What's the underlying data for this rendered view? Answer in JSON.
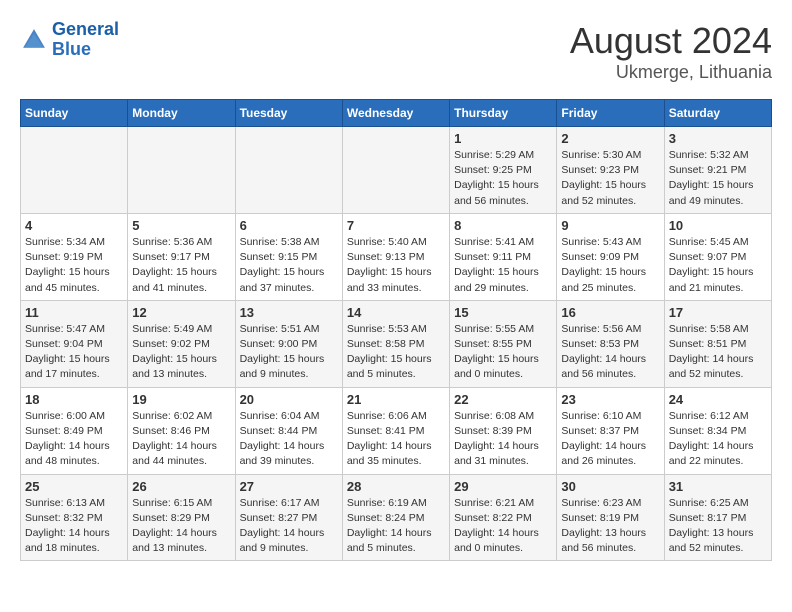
{
  "logo": {
    "line1": "General",
    "line2": "Blue"
  },
  "title": "August 2024",
  "subtitle": "Ukmerge, Lithuania",
  "days_of_week": [
    "Sunday",
    "Monday",
    "Tuesday",
    "Wednesday",
    "Thursday",
    "Friday",
    "Saturday"
  ],
  "weeks": [
    {
      "cells": [
        {
          "day": null,
          "content": null
        },
        {
          "day": null,
          "content": null
        },
        {
          "day": null,
          "content": null
        },
        {
          "day": null,
          "content": null
        },
        {
          "day": "1",
          "content": "Sunrise: 5:29 AM\nSunset: 9:25 PM\nDaylight: 15 hours\nand 56 minutes."
        },
        {
          "day": "2",
          "content": "Sunrise: 5:30 AM\nSunset: 9:23 PM\nDaylight: 15 hours\nand 52 minutes."
        },
        {
          "day": "3",
          "content": "Sunrise: 5:32 AM\nSunset: 9:21 PM\nDaylight: 15 hours\nand 49 minutes."
        }
      ]
    },
    {
      "cells": [
        {
          "day": "4",
          "content": "Sunrise: 5:34 AM\nSunset: 9:19 PM\nDaylight: 15 hours\nand 45 minutes."
        },
        {
          "day": "5",
          "content": "Sunrise: 5:36 AM\nSunset: 9:17 PM\nDaylight: 15 hours\nand 41 minutes."
        },
        {
          "day": "6",
          "content": "Sunrise: 5:38 AM\nSunset: 9:15 PM\nDaylight: 15 hours\nand 37 minutes."
        },
        {
          "day": "7",
          "content": "Sunrise: 5:40 AM\nSunset: 9:13 PM\nDaylight: 15 hours\nand 33 minutes."
        },
        {
          "day": "8",
          "content": "Sunrise: 5:41 AM\nSunset: 9:11 PM\nDaylight: 15 hours\nand 29 minutes."
        },
        {
          "day": "9",
          "content": "Sunrise: 5:43 AM\nSunset: 9:09 PM\nDaylight: 15 hours\nand 25 minutes."
        },
        {
          "day": "10",
          "content": "Sunrise: 5:45 AM\nSunset: 9:07 PM\nDaylight: 15 hours\nand 21 minutes."
        }
      ]
    },
    {
      "cells": [
        {
          "day": "11",
          "content": "Sunrise: 5:47 AM\nSunset: 9:04 PM\nDaylight: 15 hours\nand 17 minutes."
        },
        {
          "day": "12",
          "content": "Sunrise: 5:49 AM\nSunset: 9:02 PM\nDaylight: 15 hours\nand 13 minutes."
        },
        {
          "day": "13",
          "content": "Sunrise: 5:51 AM\nSunset: 9:00 PM\nDaylight: 15 hours\nand 9 minutes."
        },
        {
          "day": "14",
          "content": "Sunrise: 5:53 AM\nSunset: 8:58 PM\nDaylight: 15 hours\nand 5 minutes."
        },
        {
          "day": "15",
          "content": "Sunrise: 5:55 AM\nSunset: 8:55 PM\nDaylight: 15 hours\nand 0 minutes."
        },
        {
          "day": "16",
          "content": "Sunrise: 5:56 AM\nSunset: 8:53 PM\nDaylight: 14 hours\nand 56 minutes."
        },
        {
          "day": "17",
          "content": "Sunrise: 5:58 AM\nSunset: 8:51 PM\nDaylight: 14 hours\nand 52 minutes."
        }
      ]
    },
    {
      "cells": [
        {
          "day": "18",
          "content": "Sunrise: 6:00 AM\nSunset: 8:49 PM\nDaylight: 14 hours\nand 48 minutes."
        },
        {
          "day": "19",
          "content": "Sunrise: 6:02 AM\nSunset: 8:46 PM\nDaylight: 14 hours\nand 44 minutes."
        },
        {
          "day": "20",
          "content": "Sunrise: 6:04 AM\nSunset: 8:44 PM\nDaylight: 14 hours\nand 39 minutes."
        },
        {
          "day": "21",
          "content": "Sunrise: 6:06 AM\nSunset: 8:41 PM\nDaylight: 14 hours\nand 35 minutes."
        },
        {
          "day": "22",
          "content": "Sunrise: 6:08 AM\nSunset: 8:39 PM\nDaylight: 14 hours\nand 31 minutes."
        },
        {
          "day": "23",
          "content": "Sunrise: 6:10 AM\nSunset: 8:37 PM\nDaylight: 14 hours\nand 26 minutes."
        },
        {
          "day": "24",
          "content": "Sunrise: 6:12 AM\nSunset: 8:34 PM\nDaylight: 14 hours\nand 22 minutes."
        }
      ]
    },
    {
      "cells": [
        {
          "day": "25",
          "content": "Sunrise: 6:13 AM\nSunset: 8:32 PM\nDaylight: 14 hours\nand 18 minutes."
        },
        {
          "day": "26",
          "content": "Sunrise: 6:15 AM\nSunset: 8:29 PM\nDaylight: 14 hours\nand 13 minutes."
        },
        {
          "day": "27",
          "content": "Sunrise: 6:17 AM\nSunset: 8:27 PM\nDaylight: 14 hours\nand 9 minutes."
        },
        {
          "day": "28",
          "content": "Sunrise: 6:19 AM\nSunset: 8:24 PM\nDaylight: 14 hours\nand 5 minutes."
        },
        {
          "day": "29",
          "content": "Sunrise: 6:21 AM\nSunset: 8:22 PM\nDaylight: 14 hours\nand 0 minutes."
        },
        {
          "day": "30",
          "content": "Sunrise: 6:23 AM\nSunset: 8:19 PM\nDaylight: 13 hours\nand 56 minutes."
        },
        {
          "day": "31",
          "content": "Sunrise: 6:25 AM\nSunset: 8:17 PM\nDaylight: 13 hours\nand 52 minutes."
        }
      ]
    }
  ]
}
